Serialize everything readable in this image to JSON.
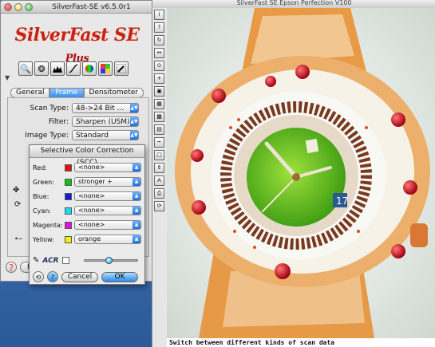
{
  "left_window": {
    "title": "SilverFast-SE v6.5.0r1",
    "logo_main": "SilverFast SE",
    "logo_plus": "Plus",
    "tools": [
      "zoom-icon",
      "aperture-icon",
      "histogram-icon",
      "gradation-curve-icon",
      "color-wheel-icon",
      "selective-color-icon",
      "pipette-icon"
    ],
    "tabs": [
      "General",
      "Frame",
      "Densitometer"
    ],
    "active_tab": "Frame",
    "scan_type_label": "Scan Type:",
    "scan_type_value": "48->24 Bit ...",
    "filter_label": "Filter:",
    "filter_value": "Sharpen (USM)",
    "image_type_label": "Image Type:",
    "image_type_value": "Standard",
    "bottom_button": "Pr"
  },
  "scc_dialog": {
    "title": "Selective Color Correction (SCC)",
    "rows": [
      {
        "label": "Red:",
        "color": "#e01010",
        "value": "<none>"
      },
      {
        "label": "Green:",
        "color": "#10c010",
        "value": "stronger +"
      },
      {
        "label": "Blue:",
        "color": "#1020d0",
        "value": "<none>"
      },
      {
        "label": "Cyan:",
        "color": "#10e0f0",
        "value": "<none>"
      },
      {
        "label": "Magenta:",
        "color": "#e010e0",
        "value": "<none>"
      },
      {
        "label": "Yellow:",
        "color": "#f0f010",
        "value": "orange"
      }
    ],
    "acr_label": "ACR",
    "slider_value": 0.45,
    "cancel_label": "Cancel",
    "ok_label": "OK"
  },
  "preview_window": {
    "title": "SilverFast SE Epson Perfection V100",
    "status_text": "Switch between different kinds of scan data"
  }
}
